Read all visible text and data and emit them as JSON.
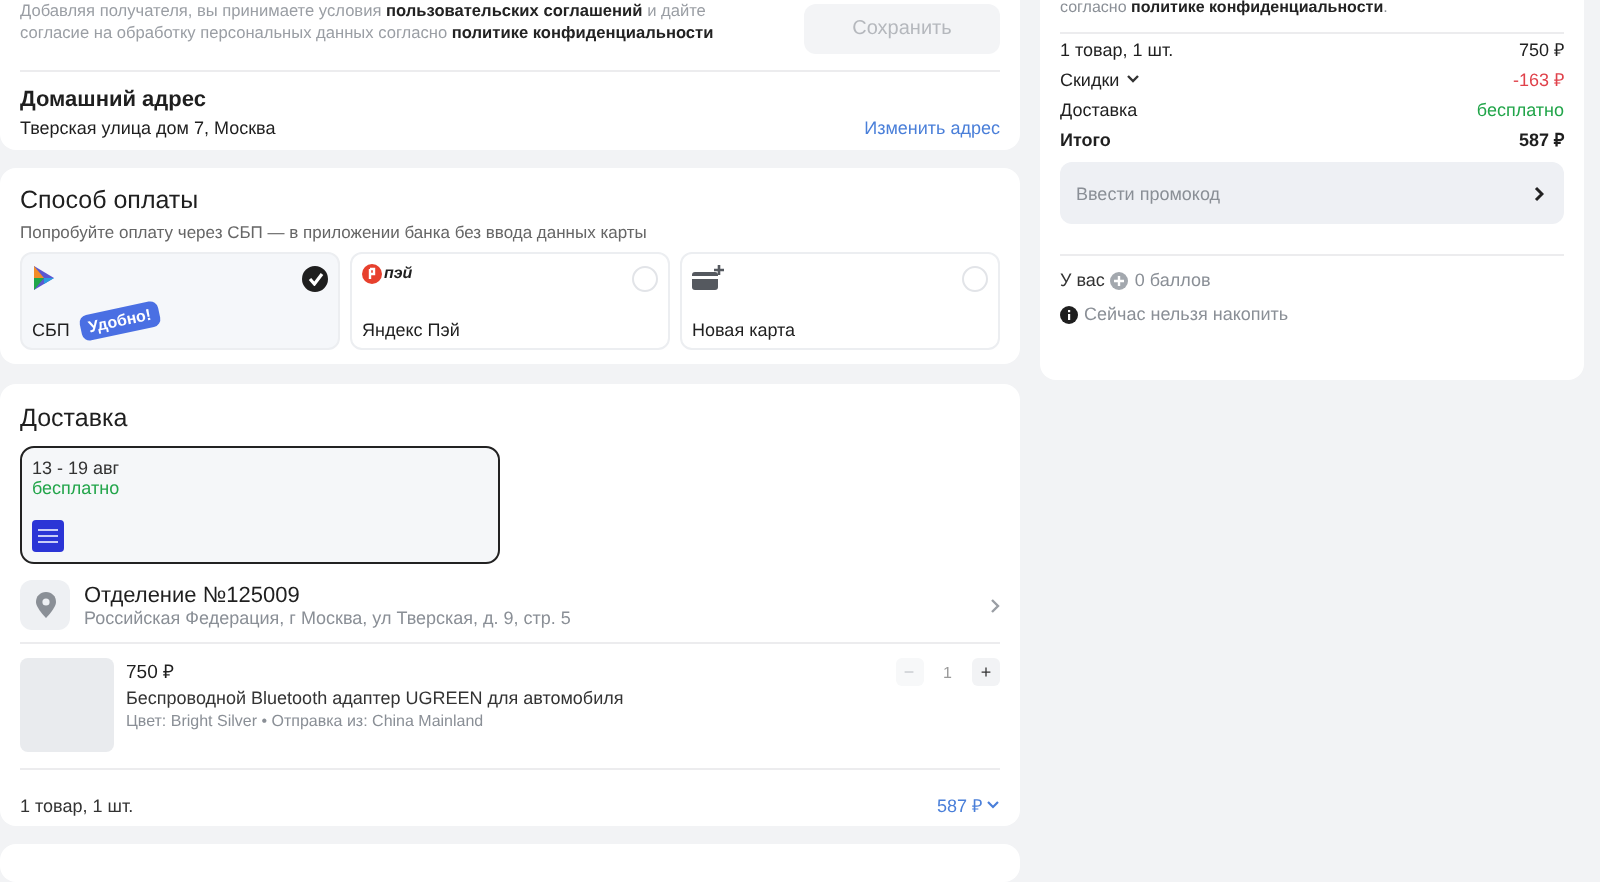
{
  "consent": {
    "text": "Добавляя получателя, вы принимаете условия **пользовательских соглашений** и дайте согласие на обработку персональных данных согласно **политике конфиденциальности**",
    "save_button": {
      "label": "Сохранить",
      "disabled": true
    }
  },
  "home_address": {
    "title": "Домашний адрес",
    "address": "Тверская улица дом 7, Москва",
    "change_link": "Изменить адрес"
  },
  "payment": {
    "title": "Способ оплаты",
    "subtitle": "Попробуйте оплату через СБП — в приложении банка без ввода данных карты",
    "options": [
      {
        "kind": "sbp",
        "label": "СБП",
        "badge": "Удобно!",
        "selected": true
      },
      {
        "kind": "yandex_pay",
        "logo_text": "пэй",
        "label": "Яндекс Пэй",
        "selected": false
      },
      {
        "kind": "card",
        "label": "Новая карта",
        "selected": false
      }
    ]
  },
  "delivery": {
    "title": "Доставка",
    "option": {
      "dates": "13 - 19 авг",
      "price": "бесплатно",
      "selected": true
    },
    "pickup": {
      "title": "Отделение №125009",
      "address": "Российская Федерация, г Москва, ул Тверская, д. 9, стр. 5"
    },
    "product": {
      "price": "750 ₽",
      "name": "Беспроводной Bluetooth адаптер UGREEN для автомобиля",
      "meta": "Цвет: Bright Silver • Отправка из: China Mainland",
      "minus": "−",
      "quantity": "1",
      "plus": "+",
      "minus_disabled": true
    },
    "footer": {
      "count": "1 товар, 1 шт.",
      "total": "587 ₽"
    }
  },
  "summary": {
    "top_text": "согласно **политике конфиденциальности**.",
    "rows": [
      {
        "kind": "normal",
        "label": "1 товар, 1 шт.",
        "value": "750 ₽"
      },
      {
        "kind": "discount",
        "label": "Скидки",
        "value": "-163 ₽"
      },
      {
        "kind": "free",
        "label": "Доставка",
        "value": "бесплатно"
      },
      {
        "kind": "total",
        "label": "Итого",
        "value": "587 ₽"
      }
    ],
    "promo_placeholder": "Ввести промокод",
    "points": {
      "prefix": "У вас",
      "value": "0 баллов"
    },
    "info": "Сейчас нельзя накопить"
  }
}
